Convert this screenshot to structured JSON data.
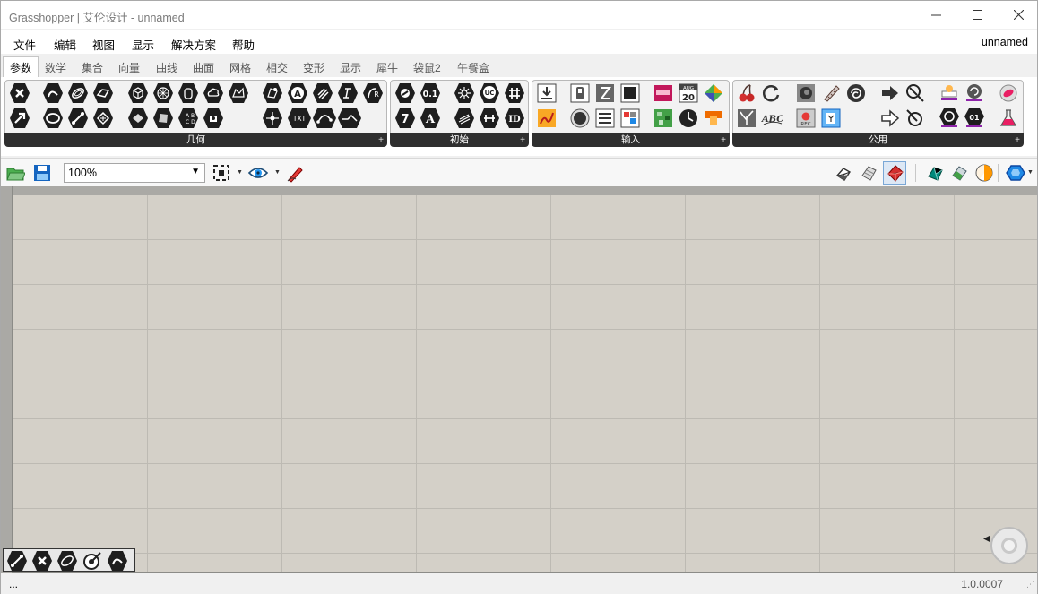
{
  "window": {
    "title": "Grasshopper | 艾伦设计 - unnamed",
    "minimize_glyph": "—",
    "maximize_glyph": "☐",
    "close_glyph": "✕"
  },
  "menu": {
    "items": [
      "文件",
      "编辑",
      "视图",
      "显示",
      "解决方案",
      "帮助"
    ],
    "document_name": "unnamed"
  },
  "tabs": [
    "参数",
    "数学",
    "集合",
    "向量",
    "曲线",
    "曲面",
    "网格",
    "相交",
    "变形",
    "显示",
    "犀牛",
    "袋鼠2",
    "午餐盒"
  ],
  "active_tab": "参数",
  "panels": [
    {
      "label": "几何"
    },
    {
      "label": "初始"
    },
    {
      "label": "输入"
    },
    {
      "label": "公用"
    }
  ],
  "panel_expand_glyph": "+",
  "component_glyphs": {
    "init_number": "0.1",
    "init_integer": "7",
    "init_text": "A",
    "init_id": "ID",
    "calendar_month": "AUG",
    "calendar_day": "20",
    "text_tag": "TXT",
    "abc": "ABC",
    "rec": "REC"
  },
  "toolbar": {
    "zoom_value": "100%"
  },
  "status": {
    "left": "...",
    "version": "1.0.0007"
  },
  "colors": {
    "canvas": "#d4d0c8",
    "grid_line": "#bdbab3",
    "panel_label_bg": "#2f2f2f",
    "icon_hex": "#1e1e1e"
  }
}
